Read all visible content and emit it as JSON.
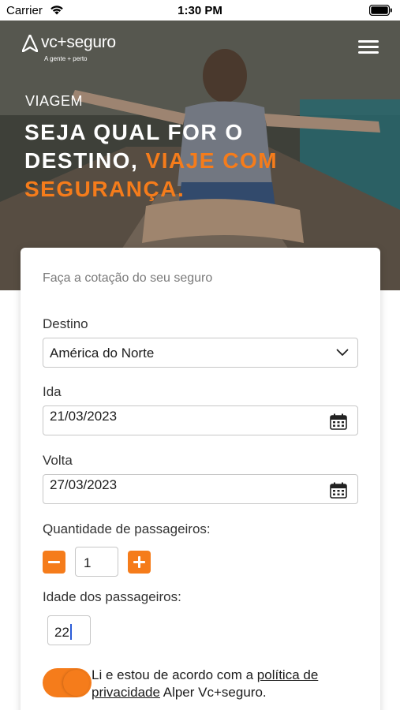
{
  "status_bar": {
    "carrier": "Carrier",
    "time": "1:30 PM"
  },
  "header": {
    "logo_text": "vc+seguro",
    "logo_tagline": "A gente + perto"
  },
  "hero": {
    "eyebrow": "VIAGEM",
    "title_part1": "SEJA QUAL FOR O DESTINO, ",
    "title_accent": "VIAJE COM SEGURANÇA."
  },
  "quote_form": {
    "title": "Faça a cotação do seu seguro",
    "destination": {
      "label": "Destino",
      "selected": "América do Norte"
    },
    "departure": {
      "label": "Ida",
      "value": "21/03/2023"
    },
    "return": {
      "label": "Volta",
      "value": "27/03/2023"
    },
    "passengers": {
      "label": "Quantidade de passageiros:",
      "quantity": "1"
    },
    "ages": {
      "label": "Idade dos passageiros:",
      "value": "22"
    },
    "consent": {
      "text_before": "Li e estou de acordo com a ",
      "link_text": "política de privacidade",
      "text_after": " Alper Vc+seguro.",
      "checked": true
    }
  },
  "colors": {
    "accent": "#f57c1b",
    "input_border": "#c7c7c7",
    "hero_text": "#ffffff"
  }
}
